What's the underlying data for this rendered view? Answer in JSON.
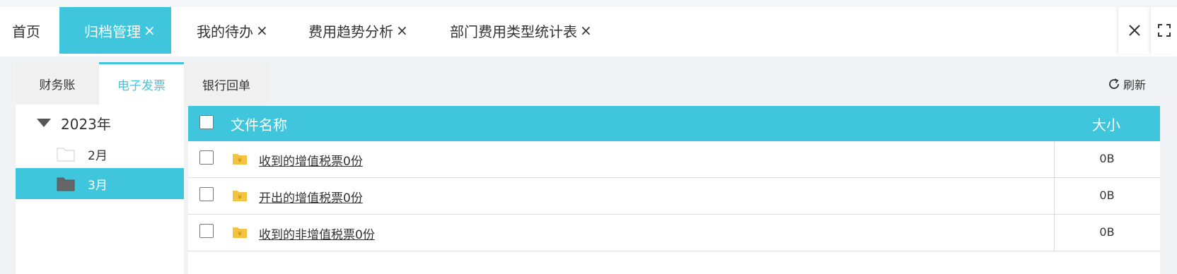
{
  "tabs": {
    "home": "首页",
    "archive": "归档管理",
    "todo": "我的待办",
    "trend": "费用趋势分析",
    "dept": "部门费用类型统计表",
    "close_glyph": "×"
  },
  "subtabs": {
    "finance": "财务账",
    "invoice": "电子发票",
    "bank": "银行回单"
  },
  "refresh_label": "刷新",
  "tree": {
    "year": "2023年",
    "months": [
      "2月",
      "3月"
    ],
    "selected_month": "3月"
  },
  "table": {
    "headers": {
      "name": "文件名称",
      "size": "大小"
    },
    "rows": [
      {
        "name": "收到的增值税票0份",
        "size": "0B"
      },
      {
        "name": "开出的增值税票0份",
        "size": "0B"
      },
      {
        "name": "收到的非增值税票0份",
        "size": "0B"
      }
    ]
  },
  "colors": {
    "accent": "#3fc6dd",
    "folder_yellow": "#f5c342"
  },
  "icons": [
    "close-icon",
    "fullscreen-icon",
    "refresh-icon",
    "caret-down-icon",
    "folder-icon",
    "file-folder-icon"
  ]
}
